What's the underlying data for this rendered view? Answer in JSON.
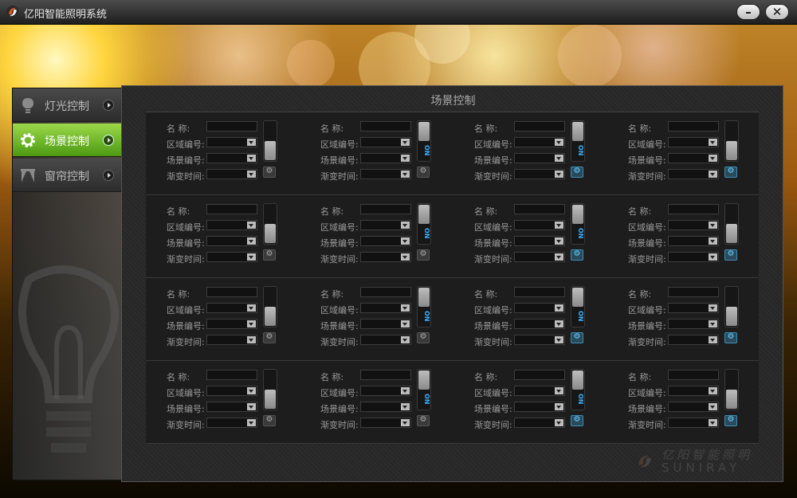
{
  "window": {
    "title": "亿阳智能照明系统",
    "minimize_glyph": "–",
    "close_glyph": "✕"
  },
  "sidebar": {
    "items": [
      {
        "label": "灯光控制",
        "icon": "bulb-icon",
        "active": false
      },
      {
        "label": "场景控制",
        "icon": "gear-icon",
        "active": true
      },
      {
        "label": "窗帘控制",
        "icon": "curtain-icon",
        "active": false
      }
    ]
  },
  "panel": {
    "title": "场景控制"
  },
  "scene_fields": {
    "name": "名 称:",
    "area": "区域编号:",
    "scene": "场景编号:",
    "fade": "渐变时间:"
  },
  "toggle_on_text": "ON",
  "scene_rows": [
    {
      "cards": [
        {
          "on": false
        },
        {
          "on": true
        },
        {
          "on": true
        },
        {
          "on": false
        }
      ]
    },
    {
      "cards": [
        {
          "on": false
        },
        {
          "on": true
        },
        {
          "on": true
        },
        {
          "on": false
        }
      ]
    },
    {
      "cards": [
        {
          "on": false
        },
        {
          "on": true
        },
        {
          "on": true
        },
        {
          "on": false
        }
      ]
    },
    {
      "cards": [
        {
          "on": false
        },
        {
          "on": true
        },
        {
          "on": true
        },
        {
          "on": false
        }
      ]
    }
  ],
  "gear_active": [
    [
      false,
      false,
      true,
      true
    ],
    [
      false,
      false,
      true,
      true
    ],
    [
      false,
      false,
      true,
      true
    ],
    [
      false,
      false,
      true,
      true
    ]
  ],
  "watermark": {
    "cn": "亿阳智能照明",
    "en": "SUNIRAY"
  },
  "colors": {
    "accent_green": "#7cc229",
    "accent_blue": "#3ab0ff"
  }
}
